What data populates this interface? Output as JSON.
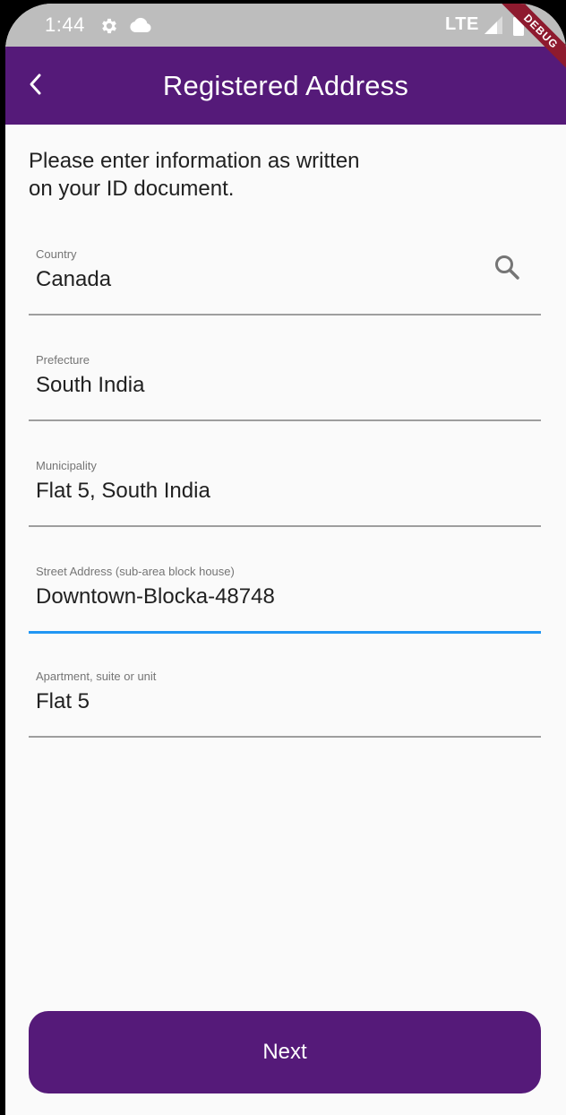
{
  "status_bar": {
    "time": "1:44",
    "network": "LTE"
  },
  "app_bar": {
    "title": "Registered Address",
    "debug_banner": "DEBUG"
  },
  "intro": {
    "line1": "Please enter information as written",
    "line2": "on your ID document."
  },
  "fields": [
    {
      "label": "Country",
      "value": "Canada"
    },
    {
      "label": "Prefecture",
      "value": "South India"
    },
    {
      "label": "Municipality",
      "value": "Flat 5, South India"
    },
    {
      "label": "Street Address (sub-area block house)",
      "value": "Downtown-Blocka-48748"
    },
    {
      "label": "Apartment, suite or unit",
      "value": "Flat 5"
    }
  ],
  "next_button": {
    "label": "Next"
  },
  "colors": {
    "brand": "#551a79",
    "focus": "#2196f3",
    "status_bar": "#bdbdbd"
  },
  "icons": {
    "back": "chevron-left-icon",
    "search": "search-icon",
    "settings": "gear-icon",
    "cloud": "cloud-icon",
    "signal": "signal-icon",
    "battery": "battery-icon"
  }
}
